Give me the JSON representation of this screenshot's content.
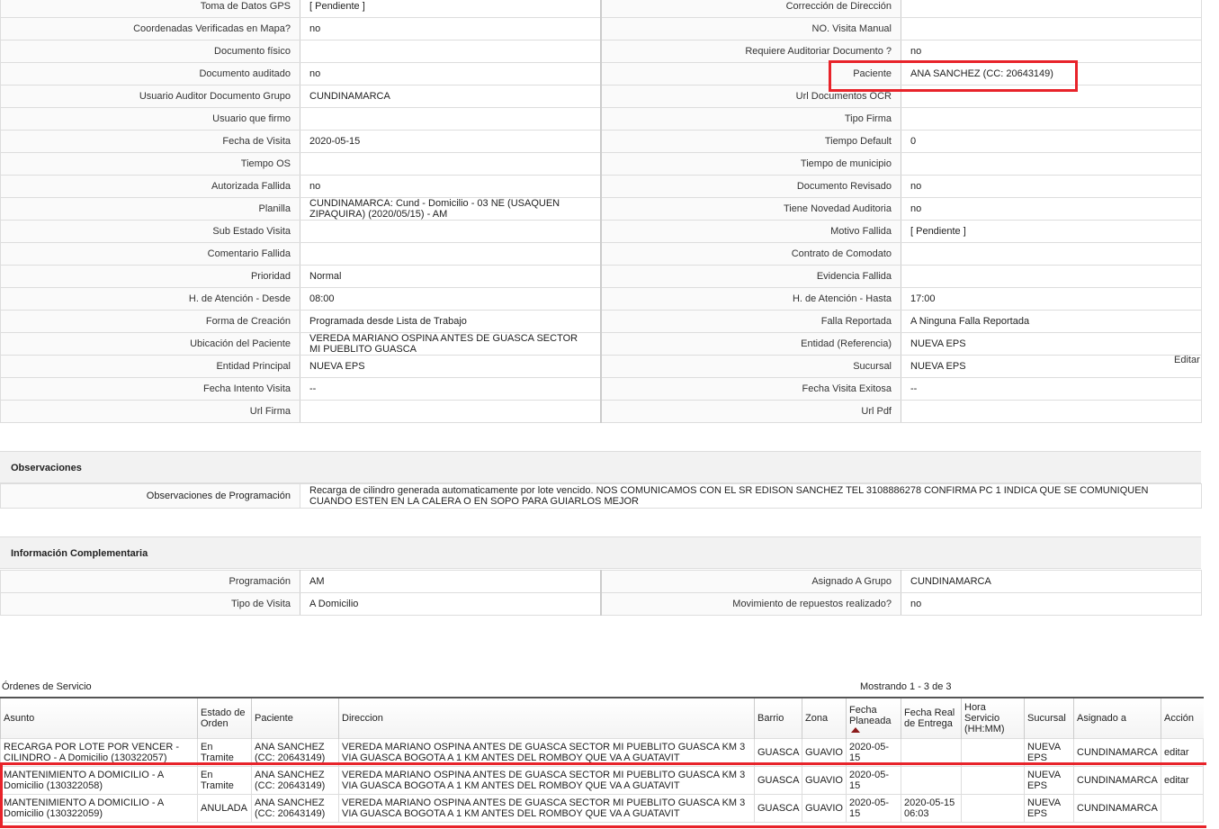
{
  "detail_rows": [
    {
      "l1": "Toma de Datos GPS",
      "v1": "[ Pendiente ]",
      "l2": "Corrección de Dirección",
      "v2": ""
    },
    {
      "l1": "Coordenadas Verificadas en Mapa?",
      "v1": "no",
      "l2": "NO. Visita Manual",
      "v2": ""
    },
    {
      "l1": "Documento físico",
      "v1": "",
      "l2": "Requiere Auditoriar Documento ?",
      "v2": "no"
    },
    {
      "l1": "Documento auditado",
      "v1": "no",
      "l2": "Paciente",
      "v2": "ANA SANCHEZ (CC: 20643149)"
    },
    {
      "l1": "Usuario Auditor Documento Grupo",
      "v1": "CUNDINAMARCA",
      "l2": "Url Documentos OCR",
      "v2": ""
    },
    {
      "l1": "Usuario que firmo",
      "v1": "",
      "l2": "Tipo Firma",
      "v2": ""
    },
    {
      "l1": "Fecha de Visita",
      "v1": "2020-05-15",
      "l2": "Tiempo Default",
      "v2": "0"
    },
    {
      "l1": "Tiempo OS",
      "v1": "",
      "l2": "Tiempo de municipio",
      "v2": ""
    },
    {
      "l1": "Autorizada Fallida",
      "v1": "no",
      "l2": "Documento Revisado",
      "v2": "no"
    },
    {
      "l1": "Planilla",
      "v1": "CUNDINAMARCA: Cund - Domicilio - 03 NE (USAQUEN ZIPAQUIRA) (2020/05/15) - AM",
      "l2": "Tiene Novedad Auditoria",
      "v2": "no"
    },
    {
      "l1": "Sub Estado Visita",
      "v1": "",
      "l2": "Motivo Fallida",
      "v2": "[ Pendiente ]"
    },
    {
      "l1": "Comentario Fallida",
      "v1": "",
      "l2": "Contrato de Comodato",
      "v2": ""
    },
    {
      "l1": "Prioridad",
      "v1": "Normal",
      "l2": "Evidencia Fallida",
      "v2": ""
    },
    {
      "l1": "H. de Atención - Desde",
      "v1": "08:00",
      "l2": "H. de Atención - Hasta",
      "v2": "17:00"
    },
    {
      "l1": "Forma de Creación",
      "v1": "Programada desde Lista de Trabajo",
      "l2": "Falla Reportada",
      "v2": "A Ninguna Falla Reportada"
    },
    {
      "l1": "Ubicación del Paciente",
      "v1": "VEREDA MARIANO OSPINA ANTES DE GUASCA SECTOR MI PUEBLITO GUASCA",
      "l2": "Entidad (Referencia)",
      "v2": "NUEVA EPS"
    },
    {
      "l1": "Entidad Principal",
      "v1": "NUEVA EPS",
      "l2": "Sucursal",
      "v2": "NUEVA EPS"
    },
    {
      "l1": "Fecha Intento Visita",
      "v1": "--",
      "l2": "Fecha Visita Exitosa",
      "v2": "--"
    },
    {
      "l1": "Url Firma",
      "v1": "",
      "l2": "Url Pdf",
      "v2": ""
    }
  ],
  "edit_link": "Editar",
  "observaciones": {
    "title": "Observaciones",
    "label": "Observaciones de Programación",
    "value": "Recarga de cilindro generada automaticamente por lote vencido. NOS COMUNICAMOS CON EL SR EDISON SANCHEZ TEL 3108886278 CONFIRMA PC 1 INDICA QUE SE COMUNIQUEN CUANDO ESTEN EN LA CALERA O EN SOPO PARA GUIARLOS MEJOR"
  },
  "complementaria": {
    "title": "Información Complementaria",
    "rows": [
      {
        "l1": "Programación",
        "v1": "AM",
        "l2": "Asignado A Grupo",
        "v2": "CUNDINAMARCA"
      },
      {
        "l1": "Tipo de Visita",
        "v1": "A Domicilio",
        "l2": "Movimiento de repuestos realizado?",
        "v2": "no"
      }
    ]
  },
  "orders": {
    "title": "Órdenes de Servicio",
    "count_text": "Mostrando 1 - 3 de 3",
    "headers": [
      "Asunto",
      "Estado de Orden",
      "Paciente",
      "Direccion",
      "Barrio",
      "Zona",
      "Fecha Planeada",
      "Fecha Real de Entrega",
      "Hora Servicio (HH:MM)",
      "Sucursal",
      "Asignado a",
      "Acción"
    ],
    "rows": [
      {
        "asunto": "RECARGA POR LOTE POR VENCER - CILINDRO - A Domicilio (130322057)",
        "estado": "En Tramite",
        "paciente": "ANA SANCHEZ (CC: 20643149)",
        "direccion": "VEREDA MARIANO OSPINA ANTES DE GUASCA SECTOR MI PUEBLITO GUASCA KM 3 VIA GUASCA BOGOTA A 1 KM ANTES DEL ROMBOY QUE VA A GUATAVIT",
        "barrio": "GUASCA",
        "zona": "GUAVIO",
        "fecha_planeada": "2020-05-15",
        "fecha_real": "",
        "hora": "",
        "sucursal": "NUEVA EPS",
        "asignado": "CUNDINAMARCA",
        "accion": "editar"
      },
      {
        "asunto": "MANTENIMIENTO A DOMICILIO - A Domicilio (130322058)",
        "estado": "En Tramite",
        "paciente": "ANA SANCHEZ (CC: 20643149)",
        "direccion": "VEREDA MARIANO OSPINA ANTES DE GUASCA SECTOR MI PUEBLITO GUASCA KM 3 VIA GUASCA BOGOTA A 1 KM ANTES DEL ROMBOY QUE VA A GUATAVIT",
        "barrio": "GUASCA",
        "zona": "GUAVIO",
        "fecha_planeada": "2020-05-15",
        "fecha_real": "",
        "hora": "",
        "sucursal": "NUEVA EPS",
        "asignado": "CUNDINAMARCA",
        "accion": "editar"
      },
      {
        "asunto": "MANTENIMIENTO A DOMICILIO - A Domicilio (130322059)",
        "estado": "ANULADA",
        "paciente": "ANA SANCHEZ (CC: 20643149)",
        "direccion": "VEREDA MARIANO OSPINA ANTES DE GUASCA SECTOR MI PUEBLITO GUASCA KM 3 VIA GUASCA BOGOTA A 1 KM ANTES DEL ROMBOY QUE VA A GUATAVIT",
        "barrio": "GUASCA",
        "zona": "GUAVIO",
        "fecha_planeada": "2020-05-15",
        "fecha_real": "2020-05-15 06:03",
        "hora": "",
        "sucursal": "NUEVA EPS",
        "asignado": "CUNDINAMARCA",
        "accion": ""
      }
    ]
  },
  "highlight_color": "#e8232a",
  "sort_icon_color": "#8b1a1a"
}
